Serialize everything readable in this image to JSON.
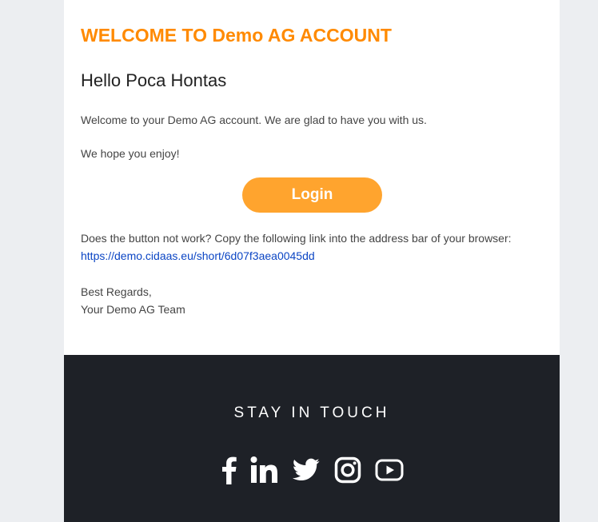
{
  "email": {
    "title": "WELCOME TO Demo AG ACCOUNT",
    "greeting": "Hello Poca Hontas",
    "paragraph1": "Welcome to your Demo AG account. We are glad to have you with us.",
    "paragraph2": "We hope you enjoy!",
    "login_label": "Login",
    "fallback_text": "Does the button not work? Copy the following link into the address bar of your browser:",
    "link_text": "https://demo.cidaas.eu/short/6d07f3aea0045dd",
    "regards_line1": "Best Regards,",
    "regards_line2": "Your Demo AG Team"
  },
  "footer": {
    "heading": "STAY IN TOUCH",
    "social_icons": [
      "facebook-icon",
      "linkedin-icon",
      "twitter-icon",
      "instagram-icon",
      "youtube-icon"
    ]
  },
  "colors": {
    "accent_title": "#ff8a00",
    "button": "#ffa42e",
    "link": "#0b45c4",
    "footer_bg": "#1e2127",
    "page_bg": "#eceef1"
  }
}
